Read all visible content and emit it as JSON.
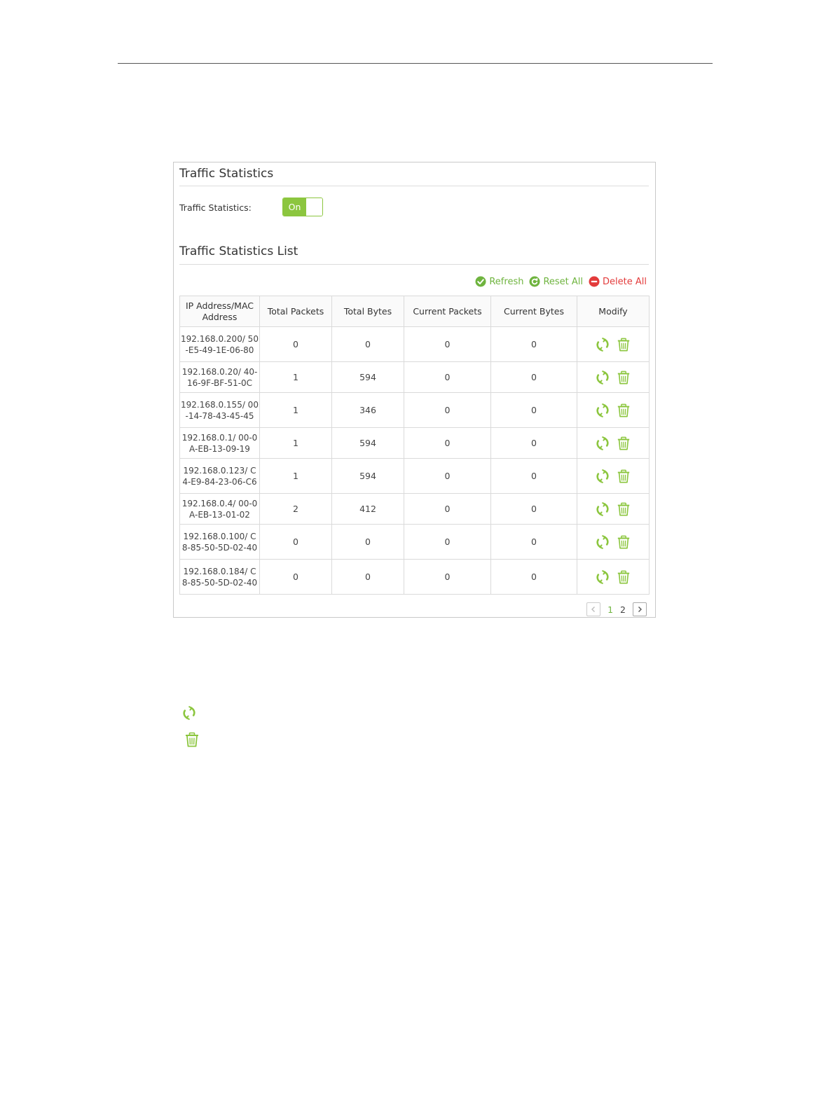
{
  "panel": {
    "title": "Traffic Statistics",
    "toggle_label": "Traffic Statistics:",
    "toggle_state": "On",
    "list_title": "Traffic Statistics List"
  },
  "actions": {
    "refresh": "Refresh",
    "reset_all": "Reset All",
    "delete_all": "Delete All"
  },
  "colors": {
    "accent": "#8cc63f",
    "action_green": "#6fb43f",
    "danger": "#e33b3b"
  },
  "table": {
    "headers": [
      "IP Address/MAC Address",
      "Total Packets",
      "Total Bytes",
      "Current Packets",
      "Current Bytes",
      "Modify"
    ],
    "rows": [
      {
        "ip_mac": "192.168.0.200/ 50-E5-49-1E-06-80",
        "total_packets": "0",
        "total_bytes": "0",
        "current_packets": "0",
        "current_bytes": "0"
      },
      {
        "ip_mac": "192.168.0.20/ 40-16-9F-BF-51-0C",
        "total_packets": "1",
        "total_bytes": "594",
        "current_packets": "0",
        "current_bytes": "0"
      },
      {
        "ip_mac": "192.168.0.155/ 00-14-78-43-45-45",
        "total_packets": "1",
        "total_bytes": "346",
        "current_packets": "0",
        "current_bytes": "0"
      },
      {
        "ip_mac": "192.168.0.1/ 00-0A-EB-13-09-19",
        "total_packets": "1",
        "total_bytes": "594",
        "current_packets": "0",
        "current_bytes": "0"
      },
      {
        "ip_mac": "192.168.0.123/ C4-E9-84-23-06-C6",
        "total_packets": "1",
        "total_bytes": "594",
        "current_packets": "0",
        "current_bytes": "0"
      },
      {
        "ip_mac": "192.168.0.4/ 00-0A-EB-13-01-02",
        "total_packets": "2",
        "total_bytes": "412",
        "current_packets": "0",
        "current_bytes": "0"
      },
      {
        "ip_mac": "192.168.0.100/ C8-85-50-5D-02-40",
        "total_packets": "0",
        "total_bytes": "0",
        "current_packets": "0",
        "current_bytes": "0"
      },
      {
        "ip_mac": "192.168.0.184/ C8-85-50-5D-02-40",
        "total_packets": "0",
        "total_bytes": "0",
        "current_packets": "0",
        "current_bytes": "0"
      }
    ],
    "row_icons": [
      "reset-icon",
      "trash-icon"
    ]
  },
  "pagination": {
    "pages": [
      "1",
      "2"
    ],
    "current": "1"
  },
  "legend_icons": [
    "reset-icon",
    "trash-icon"
  ]
}
